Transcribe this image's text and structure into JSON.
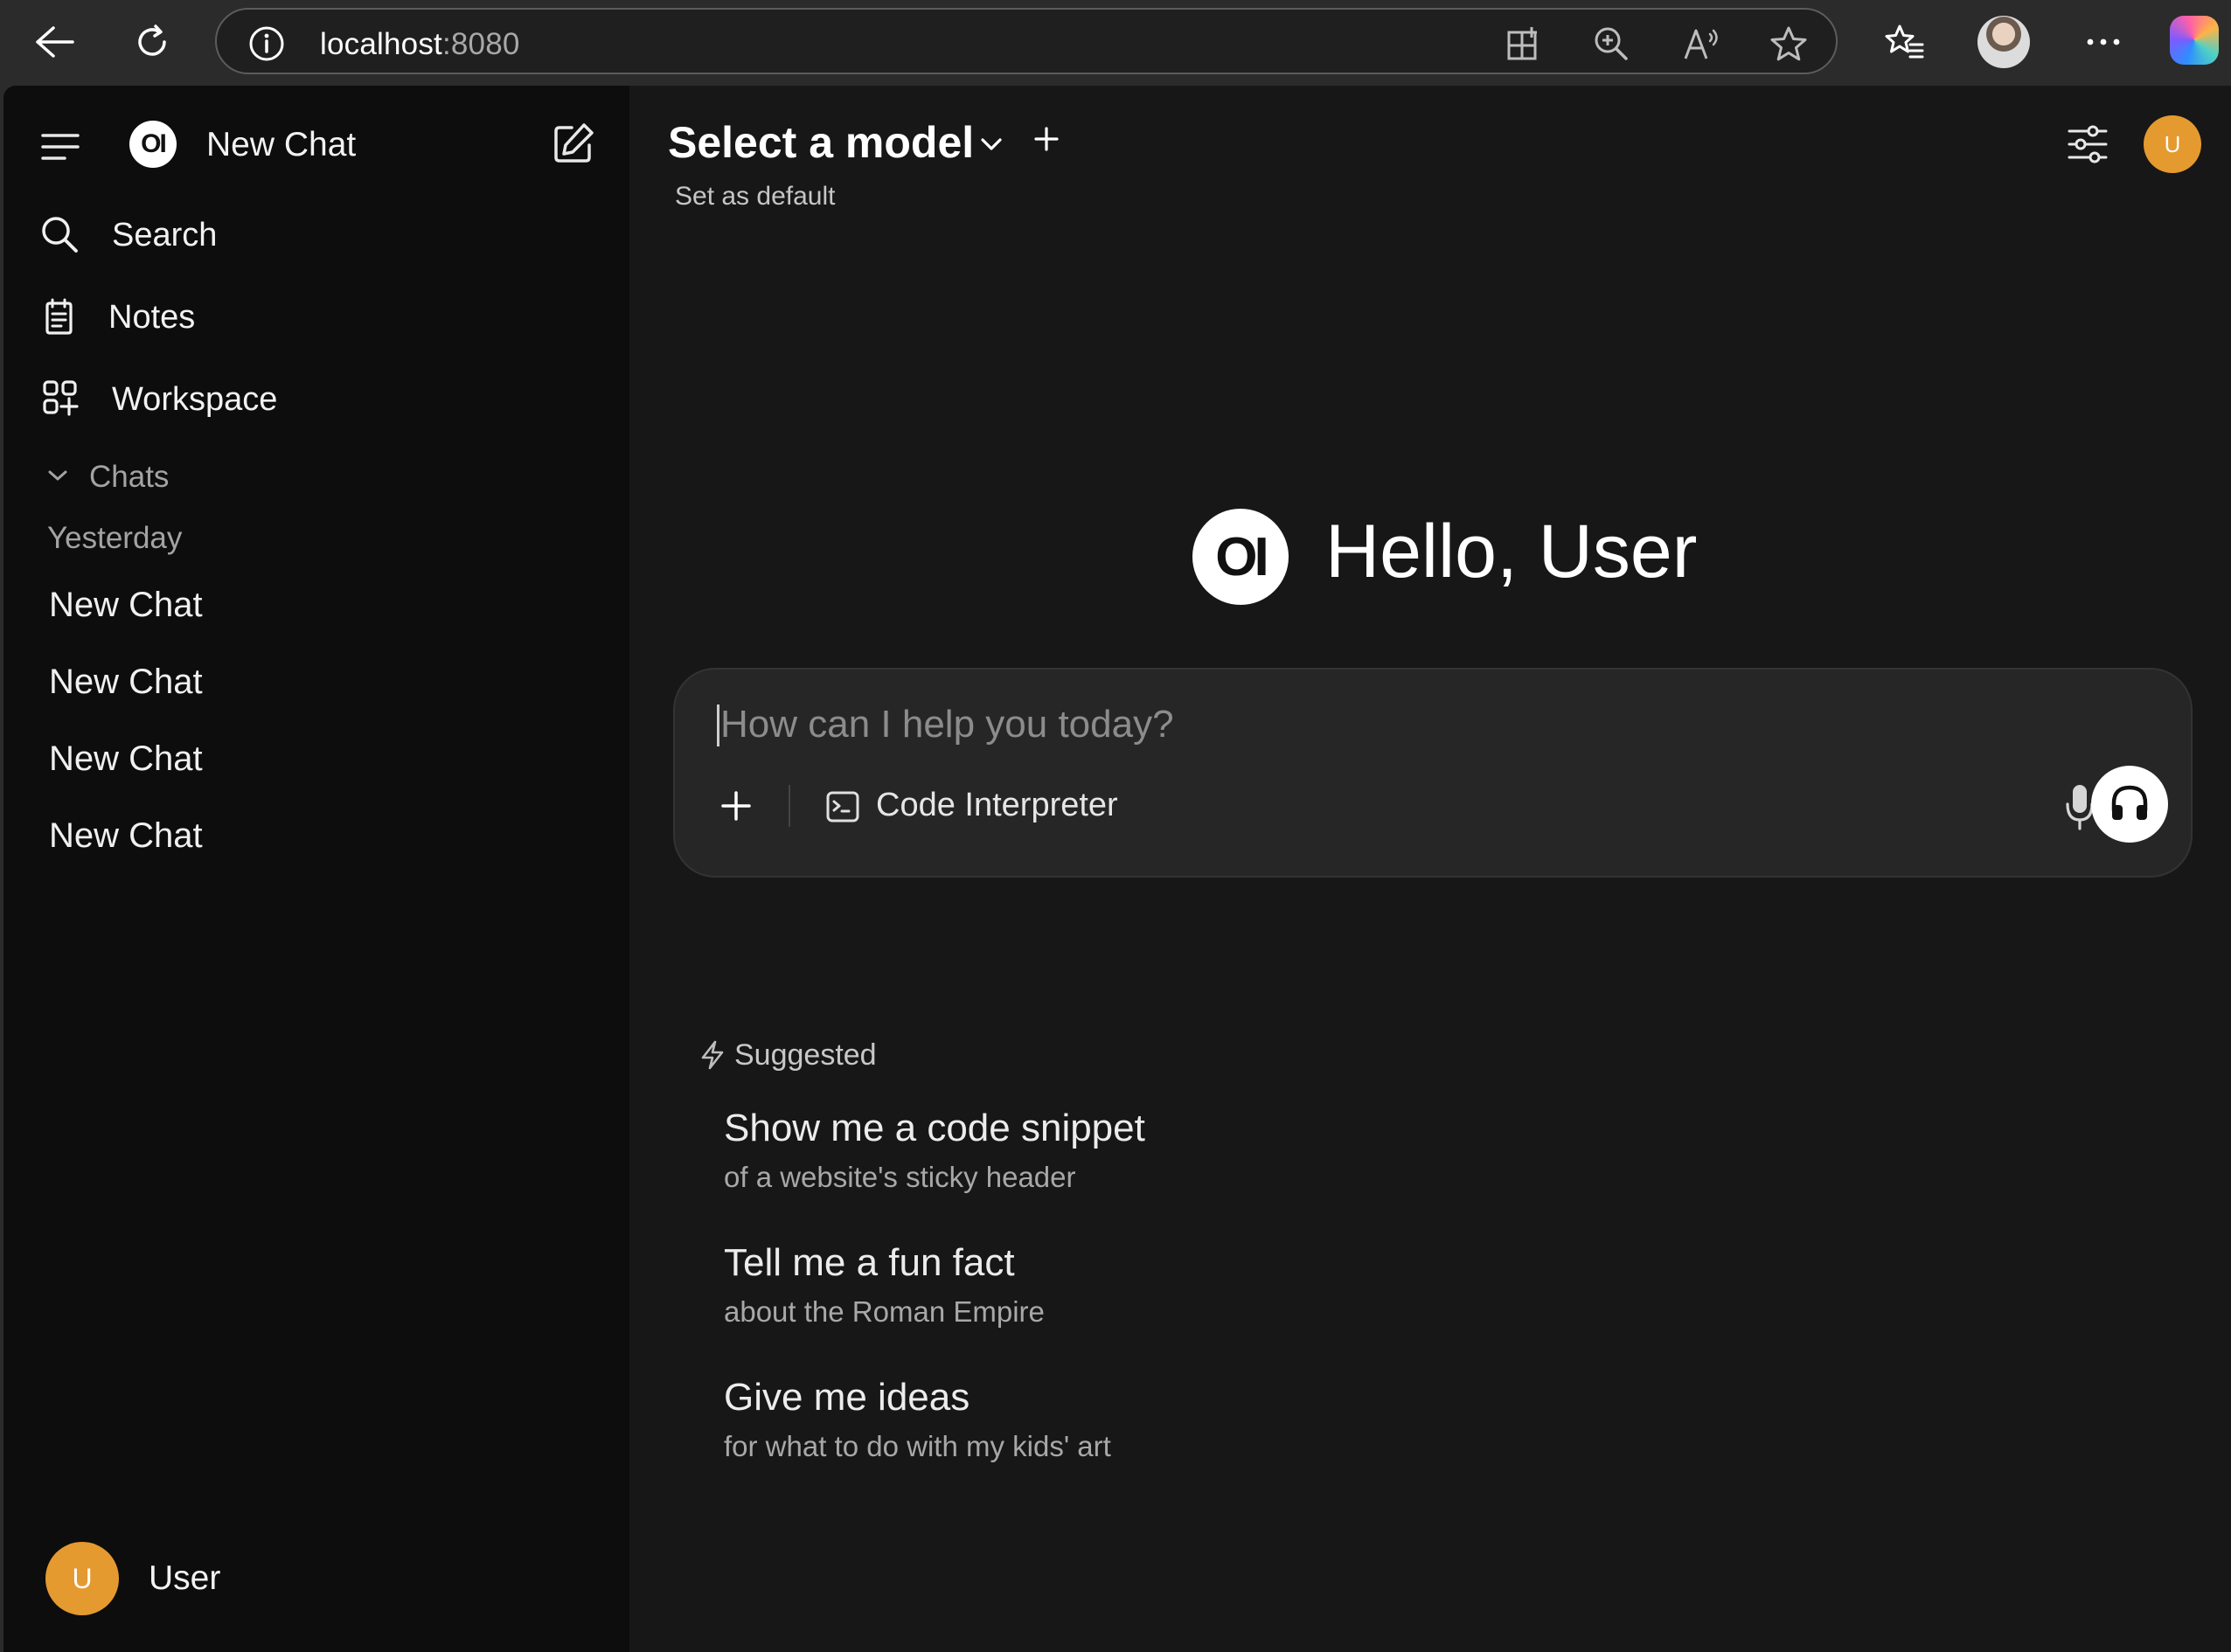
{
  "browser": {
    "url_host": "localhost",
    "url_port": ":8080"
  },
  "sidebar": {
    "brand_label": "New Chat",
    "nav": [
      {
        "label": "Search",
        "icon": "search-icon"
      },
      {
        "label": "Notes",
        "icon": "notes-icon"
      },
      {
        "label": "Workspace",
        "icon": "workspace-icon"
      }
    ],
    "chats_header": "Chats",
    "group_label": "Yesterday",
    "chats": [
      "New Chat",
      "New Chat",
      "New Chat",
      "New Chat"
    ],
    "user": {
      "avatar_initial": "U",
      "name": "User"
    }
  },
  "header": {
    "model_title": "Select a model",
    "set_default": "Set as default",
    "avatar_initial": "U"
  },
  "main": {
    "logo_text": "OI",
    "greeting": "Hello, User",
    "input_placeholder": "How can I help you today?",
    "tool_label": "Code Interpreter",
    "suggested_label": "Suggested",
    "suggestions": [
      {
        "title": "Show me a code snippet",
        "subtitle": "of a website's sticky header"
      },
      {
        "title": "Tell me a fun fact",
        "subtitle": "about the Roman Empire"
      },
      {
        "title": "Give me ideas",
        "subtitle": "for what to do with my kids' art"
      }
    ]
  },
  "colors": {
    "sidebar_bg": "#0d0d0d",
    "main_bg": "#171717",
    "avatar": "#e59a2f"
  }
}
